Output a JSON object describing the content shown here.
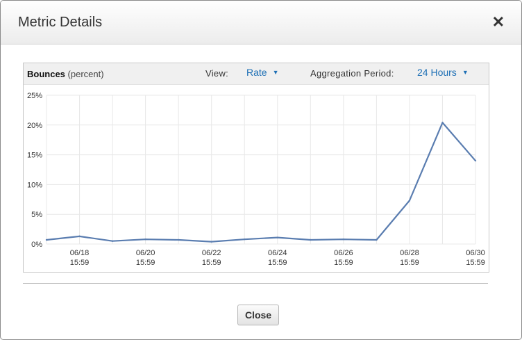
{
  "dialog": {
    "title": "Metric Details",
    "close_symbol": "✕"
  },
  "toolbar": {
    "metric": "Bounces",
    "unit": "(percent)",
    "view_label": "View:",
    "view_value": "Rate",
    "aggregation_label": "Aggregation Period:",
    "aggregation_value": "24 Hours"
  },
  "footer": {
    "close_label": "Close"
  },
  "colors": {
    "line": "#5a7db0",
    "grid": "#e8e8e8",
    "link": "#1d6fb5"
  },
  "chart_data": {
    "type": "line",
    "ylim": [
      0,
      25
    ],
    "y_ticks": [
      "0%",
      "5%",
      "10%",
      "15%",
      "20%",
      "25%"
    ],
    "x_labels": [
      {
        "date": "06/18",
        "time": "15:59"
      },
      {
        "date": "06/20",
        "time": "15:59"
      },
      {
        "date": "06/22",
        "time": "15:59"
      },
      {
        "date": "06/24",
        "time": "15:59"
      },
      {
        "date": "06/26",
        "time": "15:59"
      },
      {
        "date": "06/28",
        "time": "15:59"
      },
      {
        "date": "06/30",
        "time": "15:59"
      }
    ],
    "series": [
      {
        "values": [
          0.7,
          1.3,
          0.5,
          0.8,
          0.7,
          0.4,
          0.8,
          1.1,
          0.7,
          0.8,
          0.7,
          7.3,
          20.4,
          14.0
        ]
      }
    ],
    "grid": true,
    "legend": "none"
  }
}
